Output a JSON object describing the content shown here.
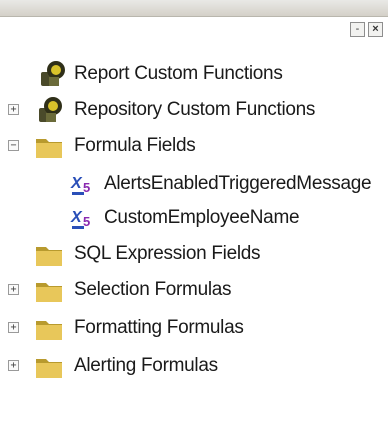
{
  "window": {
    "pin_glyph": "-",
    "close_glyph": "×"
  },
  "tree": {
    "items": [
      {
        "label": "Report Custom Functions",
        "icon": "custom-function-icon",
        "expander": ""
      },
      {
        "label": "Repository Custom Functions",
        "icon": "custom-function-icon",
        "expander": "+"
      },
      {
        "label": "Formula Fields",
        "icon": "folder-icon",
        "expander": "−"
      },
      {
        "label": "AlertsEnabledTriggeredMessage",
        "icon": "formula-icon",
        "expander": ""
      },
      {
        "label": "CustomEmployeeName",
        "icon": "formula-icon",
        "expander": ""
      },
      {
        "label": "SQL Expression Fields",
        "icon": "folder-icon",
        "expander": ""
      },
      {
        "label": "Selection Formulas",
        "icon": "folder-icon",
        "expander": "+"
      },
      {
        "label": "Formatting Formulas",
        "icon": "folder-icon",
        "expander": "+"
      },
      {
        "label": "Alerting Formulas",
        "icon": "folder-icon",
        "expander": "+"
      }
    ]
  },
  "colors": {
    "folder": "#e8c75a",
    "folder_dark": "#b89a2e",
    "formula_blue": "#2a4fb8",
    "formula_purple": "#8a2ab0",
    "function_dark": "#3b3b1e",
    "function_yellow": "#d8c22a"
  }
}
